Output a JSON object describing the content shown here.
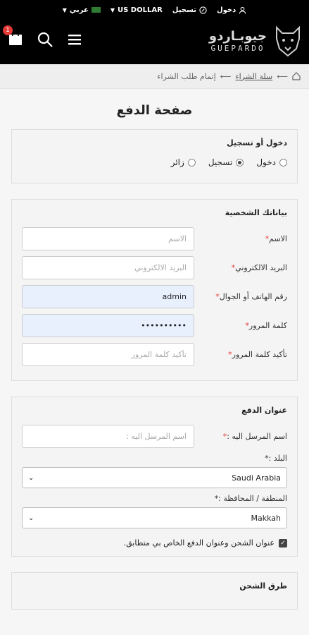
{
  "topbar": {
    "login": "دخول",
    "register": "تسجيل",
    "currency": "US DOLLAR",
    "language": "عربي"
  },
  "brand": {
    "arabic": "جيوبـاردو",
    "english": "GUEPARDO"
  },
  "cart": {
    "count": "1"
  },
  "breadcrumb": {
    "item1": "سلة الشراء",
    "item2": "إتمام طلب الشراء"
  },
  "page_title": "صفحة الدفع",
  "login_section": {
    "title": "دخول أو تسجيل",
    "options": [
      "دخول",
      "تسجيل",
      "زائر"
    ]
  },
  "personal": {
    "title": "بياناتك الشخصية",
    "name_label": "الاسم",
    "name_placeholder": "الاسم",
    "email_label": "البريد الالكتروني",
    "email_placeholder": "البريد الالكتروني",
    "phone_label": "رقم الهاتف أو الجوال",
    "phone_value": "admin",
    "password_label": "كلمة المرور",
    "password_value": "••••••••••",
    "confirm_label": "تأكيد كلمة المرور",
    "confirm_placeholder": "تأكيد كلمة المرور",
    "required_mark": "*"
  },
  "address": {
    "title": "عنوان الدفع",
    "recipient_label": "اسم المرسل اليه :",
    "recipient_placeholder": "اسم المرسل اليه :",
    "country_label": "البلد :",
    "country_value": "Saudi Arabia",
    "region_label": "المنطقة / المحافظة :",
    "region_value": "Makkah",
    "same_address_label": "عنوان الشحن وعنوان الدفع الخاص بي متطابق.",
    "required_mark": "*"
  },
  "shipping": {
    "title": "طرق الشحن"
  }
}
